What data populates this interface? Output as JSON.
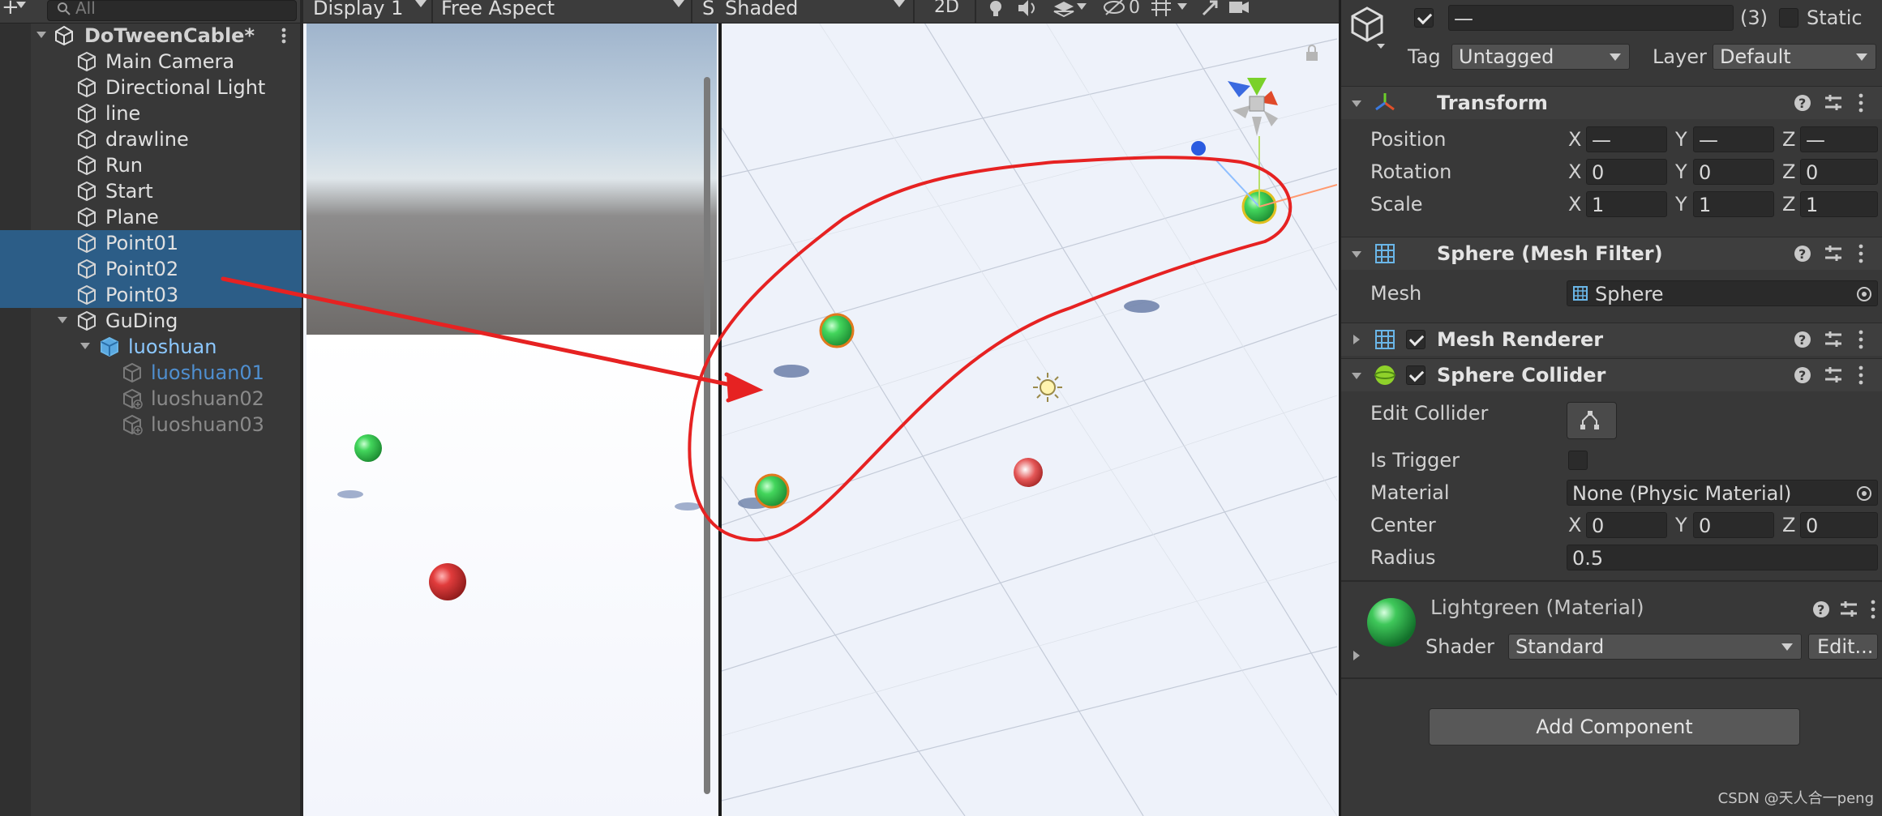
{
  "hierarchy": {
    "search_placeholder": "All",
    "scene_name": "DoTweenCable*",
    "items": [
      {
        "label": "Main Camera"
      },
      {
        "label": "Directional Light"
      },
      {
        "label": "line"
      },
      {
        "label": "drawline"
      },
      {
        "label": "Run"
      },
      {
        "label": "Start"
      },
      {
        "label": "Plane"
      },
      {
        "label": "Point01",
        "selected": true
      },
      {
        "label": "Point02",
        "selected": true
      },
      {
        "label": "Point03",
        "selected": true
      },
      {
        "label": "GuDing"
      },
      {
        "label": "luoshuan"
      },
      {
        "label": "luoshuan01"
      },
      {
        "label": "luoshuan02"
      },
      {
        "label": "luoshuan03"
      }
    ]
  },
  "game_view": {
    "display": "Display 1",
    "aspect": "Free Aspect",
    "extra": "S"
  },
  "scene_view": {
    "draw_mode": "Shaded",
    "mode_2d": "2D",
    "hidden_count": "0"
  },
  "inspector": {
    "object_name": "—",
    "count": "(3)",
    "static_label": "Static",
    "tag_label": "Tag",
    "tag_value": "Untagged",
    "layer_label": "Layer",
    "layer_value": "Default",
    "transform": {
      "title": "Transform",
      "rows": [
        {
          "label": "Position",
          "x": "—",
          "y": "—",
          "z": "—"
        },
        {
          "label": "Rotation",
          "x": "0",
          "y": "0",
          "z": "0"
        },
        {
          "label": "Scale",
          "x": "1",
          "y": "1",
          "z": "1"
        }
      ],
      "axis": {
        "x": "X",
        "y": "Y",
        "z": "Z"
      }
    },
    "mesh_filter": {
      "title": "Sphere (Mesh Filter)",
      "mesh_label": "Mesh",
      "mesh_value": "Sphere"
    },
    "mesh_renderer": {
      "title": "Mesh Renderer"
    },
    "sphere_collider": {
      "title": "Sphere Collider",
      "edit_collider": "Edit Collider",
      "is_trigger": "Is Trigger",
      "material_label": "Material",
      "material_value": "None (Physic Material)",
      "center_label": "Center",
      "center": {
        "x": "0",
        "y": "0",
        "z": "0"
      },
      "radius_label": "Radius",
      "radius_value": "0.5"
    },
    "material": {
      "title": "Lightgreen (Material)",
      "shader_label": "Shader",
      "shader_value": "Standard",
      "edit_label": "Edit..."
    },
    "add_component": "Add Component"
  },
  "watermark": "CSDN @天人合一peng",
  "colors": {
    "selection": "#2c5d87",
    "annotation_red": "#e62222",
    "sphere_green": "#3fd15a",
    "sphere_red": "#e03a3a"
  }
}
